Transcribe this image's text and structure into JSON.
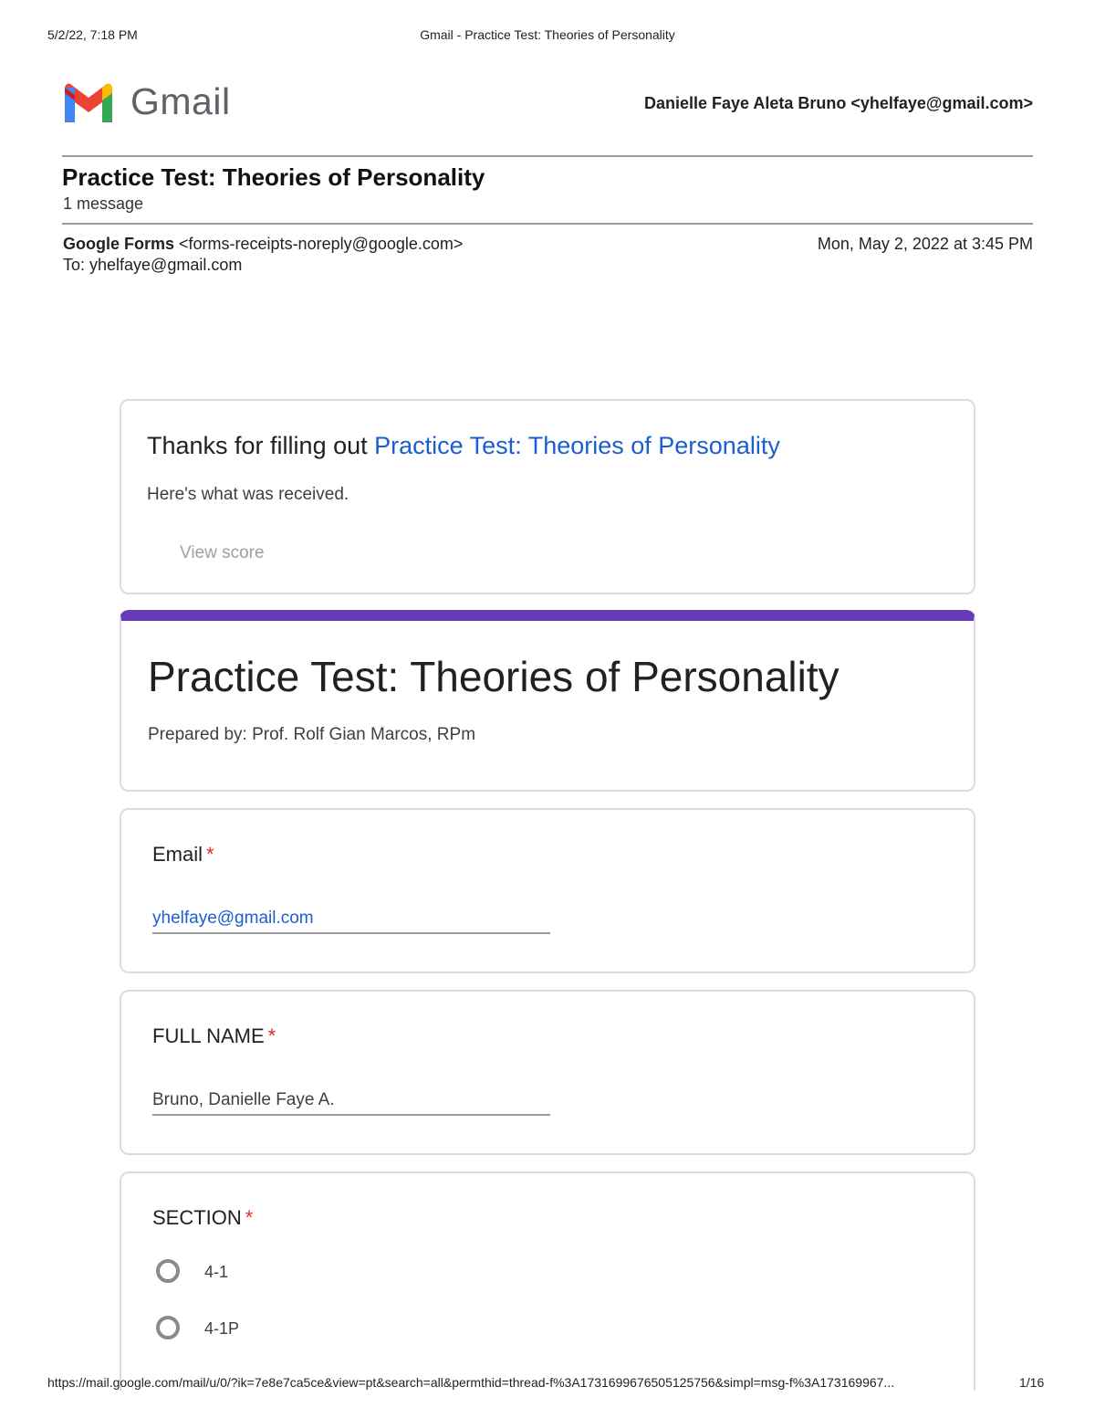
{
  "print": {
    "datetime": "5/2/22, 7:18 PM",
    "tab_title": "Gmail - Practice Test: Theories of Personality",
    "url": "https://mail.google.com/mail/u/0/?ik=7e8e7ca5ce&view=pt&search=all&permthid=thread-f%3A1731699676505125756&simpl=msg-f%3A173169967...",
    "page": "1/16"
  },
  "gmail": {
    "logo_text": "Gmail",
    "account": "Danielle Faye Aleta Bruno <yhelfaye@gmail.com>",
    "colors": {
      "red": "#ea4335",
      "blue": "#4285f4",
      "green": "#34a853",
      "yellow": "#fbbc04",
      "dark_red": "#c5221f"
    }
  },
  "thread": {
    "subject": "Practice Test: Theories of Personality",
    "count": "1 message",
    "sender_name": "Google Forms",
    "sender_email": "<forms-receipts-noreply@google.com>",
    "to": "To: yhelfaye@gmail.com",
    "date": "Mon, May 2, 2022 at 3:45 PM"
  },
  "receipt": {
    "thanks_prefix": "Thanks for filling out ",
    "form_link": "Practice Test: Theories of Personality",
    "received": "Here's what was received.",
    "view_score": "View score"
  },
  "form": {
    "accent": "#673ab7",
    "title": "Practice Test: Theories of Personality",
    "description": "Prepared by: Prof. Rolf Gian Marcos, RPm",
    "questions": [
      {
        "label": "Email",
        "required": "*",
        "answer": "yhelfaye@gmail.com"
      },
      {
        "label": "FULL NAME",
        "required": "*",
        "answer": "Bruno, Danielle Faye A."
      },
      {
        "label": "SECTION",
        "required": "*",
        "options": [
          "4-1",
          "4-1P"
        ]
      }
    ]
  }
}
